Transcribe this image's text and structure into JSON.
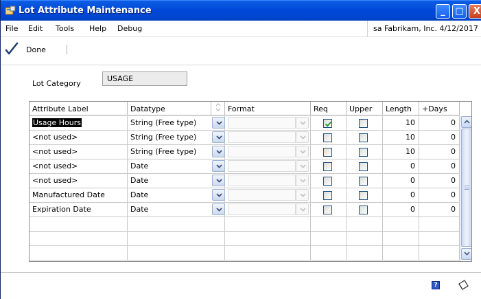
{
  "window": {
    "title": "Lot Attribute Maintenance",
    "buttons": {
      "minimize": "_",
      "maximize": "□",
      "close": "X"
    }
  },
  "menu": {
    "items": [
      "File",
      "Edit",
      "Tools",
      "Help",
      "Debug"
    ],
    "company": "sa  Fabrikam, Inc.  4/12/2017"
  },
  "toolbar": {
    "done_label": "Done"
  },
  "form": {
    "lot_category_label": "Lot Category",
    "lot_category_value": "USAGE"
  },
  "grid": {
    "columns": {
      "attribute_label": "Attribute Label",
      "datatype": "Datatype",
      "format": "Format",
      "req": "Req",
      "upper": "Upper",
      "length": "Length",
      "days": "+Days"
    },
    "rows": [
      {
        "label": "Usage Hours",
        "datatype": "String (Free type)",
        "req": true,
        "upper": false,
        "length": "10",
        "days": "0",
        "selected": true
      },
      {
        "label": "<not used>",
        "datatype": "String (Free type)",
        "req": false,
        "upper": false,
        "length": "10",
        "days": "0"
      },
      {
        "label": "<not used>",
        "datatype": "String (Free type)",
        "req": false,
        "upper": false,
        "length": "10",
        "days": "0"
      },
      {
        "label": "<not used>",
        "datatype": "Date",
        "req": false,
        "upper": false,
        "length": "0",
        "days": "0"
      },
      {
        "label": "<not used>",
        "datatype": "Date",
        "req": false,
        "upper": false,
        "length": "0",
        "days": "0"
      },
      {
        "label": "Manufactured Date",
        "datatype": "Date",
        "req": false,
        "upper": false,
        "length": "0",
        "days": "0"
      },
      {
        "label": "Expiration Date",
        "datatype": "Date",
        "req": false,
        "upper": false,
        "length": "0",
        "days": "0"
      }
    ],
    "empty_rows": 3
  },
  "colors": {
    "titlebar": "#0048d8",
    "check": "#2a9d2a"
  }
}
